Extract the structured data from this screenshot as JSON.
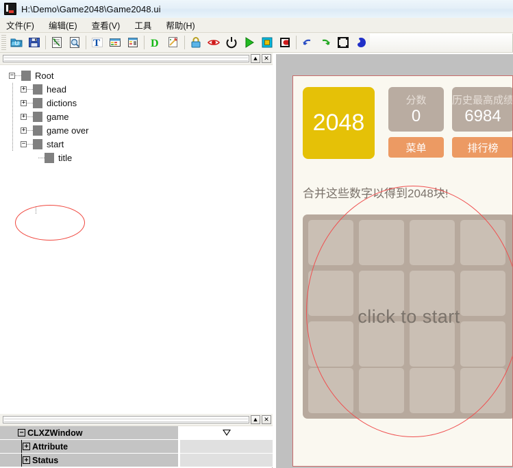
{
  "window": {
    "title": "H:\\Demo\\Game2048\\Game2048.ui",
    "app_icon": "editor-app-icon"
  },
  "menubar": {
    "items": [
      {
        "label": "文件(F)",
        "name": "menu-file"
      },
      {
        "label": "编辑(E)",
        "name": "menu-edit"
      },
      {
        "label": "查看(V)",
        "name": "menu-view"
      },
      {
        "label": "工具",
        "name": "menu-tools"
      },
      {
        "label": "帮助(H)",
        "name": "menu-help"
      }
    ]
  },
  "toolbar": {
    "buttons": [
      {
        "name": "open-folder-icon"
      },
      {
        "name": "save-icon"
      },
      {
        "sep": true
      },
      {
        "name": "import-document-icon"
      },
      {
        "name": "preview-search-icon"
      },
      {
        "sep": true
      },
      {
        "name": "text-tool-icon"
      },
      {
        "name": "table-grid-icon"
      },
      {
        "name": "list-panel-icon"
      },
      {
        "sep": true
      },
      {
        "name": "letter-d-icon"
      },
      {
        "name": "magic-wand-icon"
      },
      {
        "sep": true
      },
      {
        "name": "lock-icon"
      },
      {
        "name": "eye-icon"
      },
      {
        "name": "power-icon"
      },
      {
        "name": "run-play-icon"
      },
      {
        "name": "stop-square-icon"
      },
      {
        "name": "record-icon"
      },
      {
        "sep": true
      },
      {
        "name": "undo-icon"
      },
      {
        "name": "redo-icon"
      },
      {
        "name": "select-frame-icon"
      },
      {
        "name": "paint-blob-icon"
      }
    ]
  },
  "left_pane": {
    "scroll_buttons": [
      {
        "name": "tree-scroll-up-button",
        "glyph": "▲"
      },
      {
        "name": "tree-close-button",
        "glyph": "✕"
      }
    ],
    "tree": {
      "nodes": [
        {
          "label": "Root",
          "depth": 0,
          "expander": "−",
          "name": "tree-node-root"
        },
        {
          "label": "head",
          "depth": 1,
          "expander": "+",
          "name": "tree-node-head"
        },
        {
          "label": "dictions",
          "depth": 1,
          "expander": "+",
          "name": "tree-node-dictions"
        },
        {
          "label": "game",
          "depth": 1,
          "expander": "+",
          "name": "tree-node-game"
        },
        {
          "label": "game over",
          "depth": 1,
          "expander": "+",
          "name": "tree-node-game-over"
        },
        {
          "label": "start",
          "depth": 1,
          "expander": "−",
          "name": "tree-node-start"
        },
        {
          "label": "title",
          "depth": 2,
          "expander": "",
          "name": "tree-node-title"
        }
      ]
    },
    "annotation": {
      "name": "red-ellipse-tree-highlight"
    }
  },
  "bottom_pane": {
    "scroll_buttons": [
      {
        "name": "property-scroll-up-button",
        "glyph": "▲"
      },
      {
        "name": "property-close-button",
        "glyph": "✕"
      }
    ],
    "property_grid": {
      "rows": [
        {
          "label": "CLXZWindow",
          "expander": "−",
          "indent": 0,
          "value_style": "white",
          "value_glyph": "dropdown-triangle",
          "name": "property-row-clxzwindow"
        },
        {
          "label": "Attribute",
          "expander": "+",
          "indent": 1,
          "value_style": "gray",
          "value_glyph": "",
          "name": "property-row-attribute"
        },
        {
          "label": "Status",
          "expander": "+",
          "indent": 1,
          "value_style": "gray",
          "value_glyph": "",
          "name": "property-row-status"
        }
      ]
    }
  },
  "preview": {
    "logo_tile": {
      "text": "2048",
      "color": "#e5c107"
    },
    "score_boxes": [
      {
        "label": "分数",
        "value": "0",
        "name": "score-box-current"
      },
      {
        "label": "历史最高成绩",
        "value": "6984",
        "name": "score-box-best"
      }
    ],
    "buttons": [
      {
        "label": "菜单",
        "name": "menu-button",
        "color": "#ec9a63"
      },
      {
        "label": "排行榜",
        "name": "leaderboard-button",
        "color": "#ec9a63"
      }
    ],
    "subtitle": "合并这些数字以得到2048块!",
    "board": {
      "rows": 4,
      "columns": 4,
      "overlay_text": "click to start",
      "tile_color": "#cabfb4",
      "board_color": "#b7a99d"
    },
    "annotation": {
      "name": "red-ellipse-board-highlight"
    }
  }
}
